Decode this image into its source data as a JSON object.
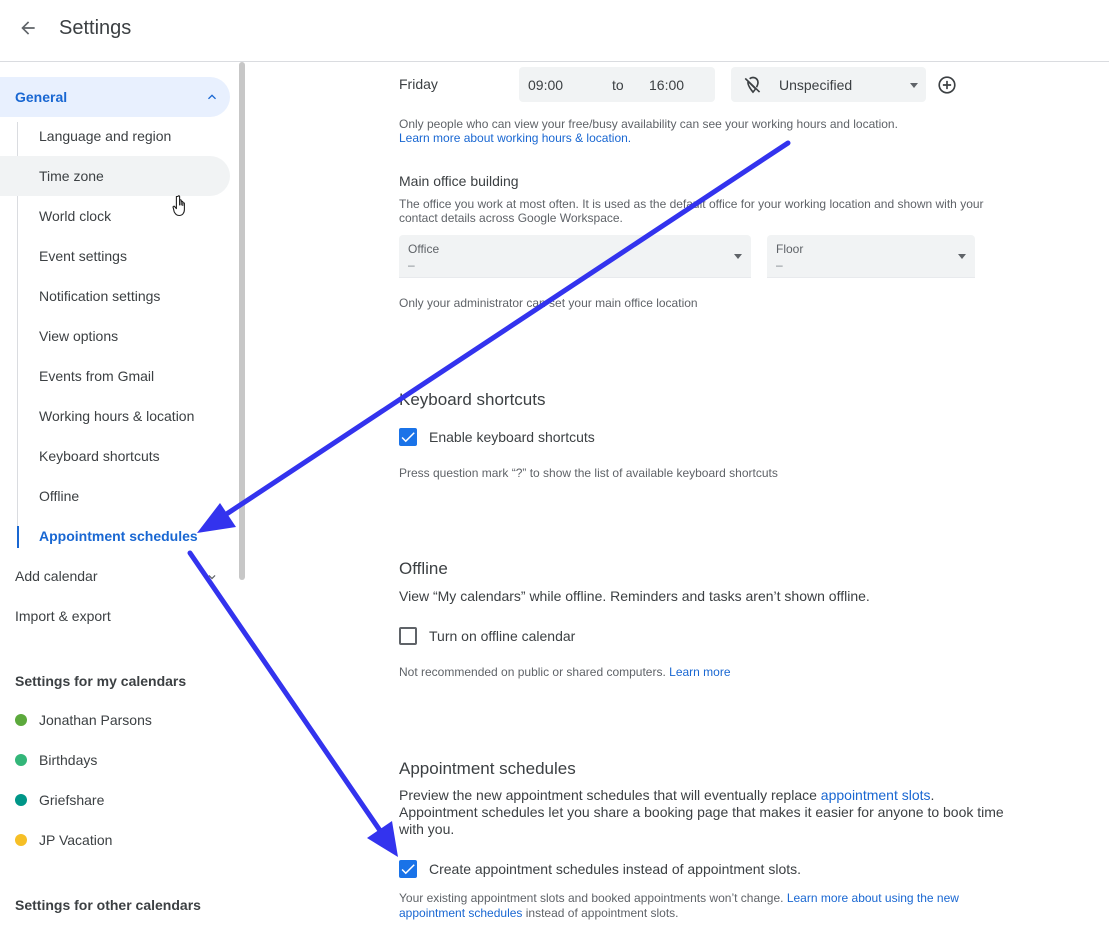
{
  "header": {
    "title": "Settings"
  },
  "sidebar": {
    "general": {
      "label": "General"
    },
    "sub_items": [
      {
        "label": "Language and region"
      },
      {
        "label": "Time zone"
      },
      {
        "label": "World clock"
      },
      {
        "label": "Event settings"
      },
      {
        "label": "Notification settings"
      },
      {
        "label": "View options"
      },
      {
        "label": "Events from Gmail"
      },
      {
        "label": "Working hours & location"
      },
      {
        "label": "Keyboard shortcuts"
      },
      {
        "label": "Offline"
      },
      {
        "label": "Appointment schedules"
      }
    ],
    "add_calendar": "Add calendar",
    "import_export": "Import & export",
    "my_calendars_heading": "Settings for my calendars",
    "my_calendars": [
      {
        "label": "Jonathan Parsons",
        "color": "#33b679"
      },
      {
        "label": "Birthdays",
        "color": "#33b679"
      },
      {
        "label": "Griefshare",
        "color": "#009688"
      },
      {
        "label": "JP Vacation",
        "color": "#f6bf26"
      }
    ],
    "other_calendars_heading": "Settings for other calendars"
  },
  "working_hours": {
    "day": "Friday",
    "start": "09:00",
    "to": "to",
    "end": "16:00",
    "location": "Unspecified",
    "note": "Only people who can view your free/busy availability can see your working hours and location.",
    "learn_more": "Learn more about working hours & location."
  },
  "office": {
    "title": "Main office building",
    "desc_line1": "The office you work at most often. It is used as the default office for your working location and shown with your",
    "desc_line2": "contact details across Google Workspace.",
    "office_label": "Office",
    "office_value": "–",
    "floor_label": "Floor",
    "floor_value": "–",
    "admin_note": "Only your administrator can set your main office location"
  },
  "keyboard": {
    "title": "Keyboard shortcuts",
    "checkbox_label": "Enable keyboard shortcuts",
    "hint": "Press question mark “?” to show the list of available keyboard shortcuts"
  },
  "offline": {
    "title": "Offline",
    "desc": "View “My calendars” while offline. Reminders and tasks aren’t shown offline.",
    "checkbox_label": "Turn on offline calendar",
    "note": "Not recommended on public or shared computers.",
    "learn_more": "Learn more"
  },
  "appointments": {
    "title": "Appointment schedules",
    "desc_part1": "Preview the new appointment schedules that will eventually replace ",
    "desc_link": "appointment slots",
    "desc_part2": ".",
    "desc_line2": "Appointment schedules let you share a booking page that makes it easier for anyone to book time",
    "desc_line3": "with you.",
    "checkbox_label": "Create appointment schedules instead of appointment slots.",
    "note_part1": "Your existing appointment slots and booked appointments won’t change. ",
    "note_link1": "Learn more about using the new",
    "note_link2": "appointment schedules",
    "note_part2": " instead of appointment slots."
  },
  "colors": {
    "accent": "#1967d2",
    "annotation_arrow": "#3333ee"
  }
}
